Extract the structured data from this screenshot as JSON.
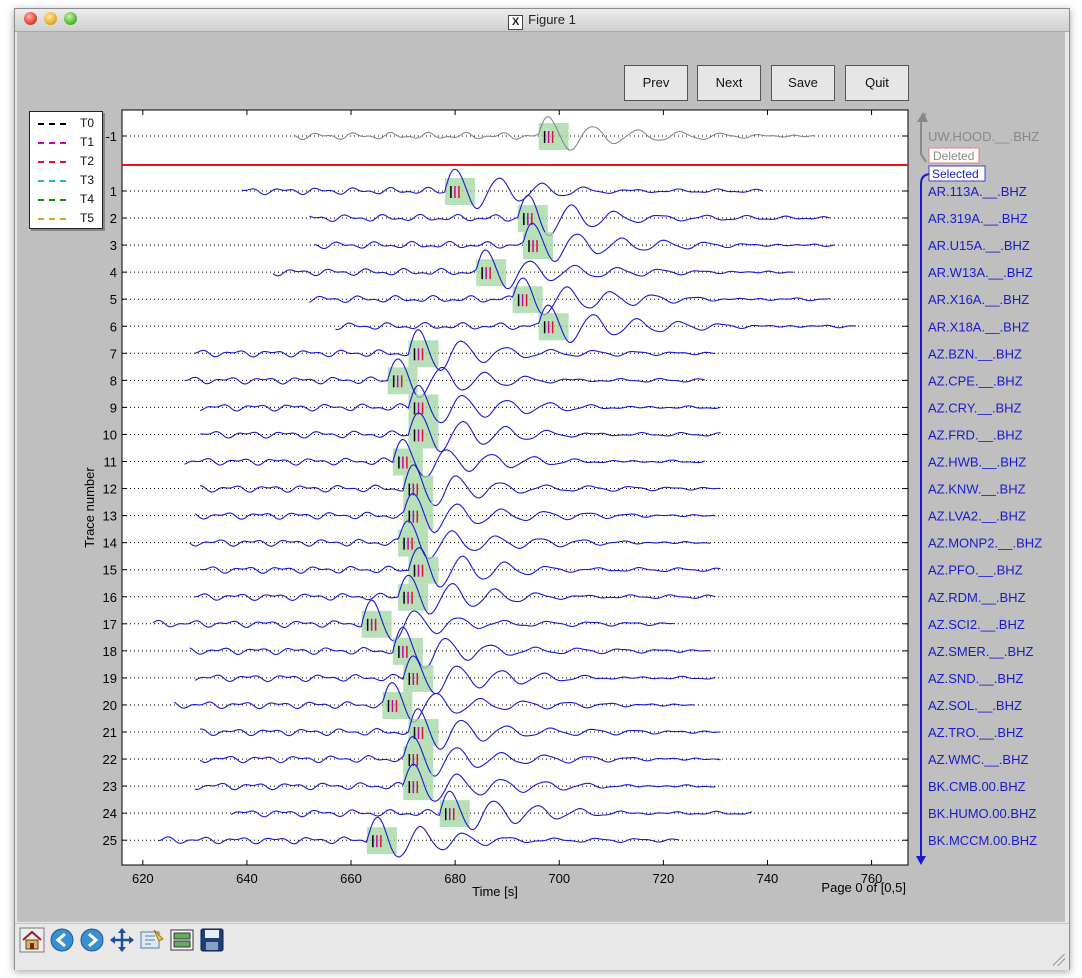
{
  "window": {
    "title": "Figure 1"
  },
  "buttons": {
    "prev": "Prev",
    "next": "Next",
    "save": "Save",
    "quit": "Quit"
  },
  "legend": [
    {
      "label": "T0",
      "color": "#000000"
    },
    {
      "label": "T1",
      "color": "#cc00aa"
    },
    {
      "label": "T2",
      "color": "#dd1133"
    },
    {
      "label": "T3",
      "color": "#22bbbb"
    },
    {
      "label": "T4",
      "color": "#118811"
    },
    {
      "label": "T5",
      "color": "#ccaa22"
    }
  ],
  "axes": {
    "xlabel": "Time [s]",
    "ylabel": "Trace number",
    "x_ticks": [
      620,
      640,
      660,
      680,
      700,
      720,
      740,
      760
    ],
    "x_range": [
      616,
      767
    ],
    "page_text": "Page 0 of [0,5]"
  },
  "labels": {
    "deleted": "Deleted",
    "selected": "Selected"
  },
  "colors": {
    "selected": "#1a1acc",
    "deleted": "#888888",
    "separator": "#ee1111",
    "pick_box": "#9fd5a0"
  },
  "chart_data": {
    "type": "line",
    "deleted_trace": {
      "number": "-1",
      "station": "UW.HOOD.__.BHZ",
      "start": 649,
      "end": 749,
      "pick": 697
    },
    "traces": [
      {
        "number": "1",
        "station": "AR.113A.__.BHZ",
        "start": 639,
        "end": 739,
        "pick": 679
      },
      {
        "number": "2",
        "station": "AR.319A.__.BHZ",
        "start": 652,
        "end": 752,
        "pick": 693
      },
      {
        "number": "3",
        "station": "AR.U15A.__.BHZ",
        "start": 653,
        "end": 753,
        "pick": 694
      },
      {
        "number": "4",
        "station": "AR.W13A.__.BHZ",
        "start": 645,
        "end": 745,
        "pick": 685
      },
      {
        "number": "5",
        "station": "AR.X16A.__.BHZ",
        "start": 652,
        "end": 752,
        "pick": 692
      },
      {
        "number": "6",
        "station": "AR.X18A.__.BHZ",
        "start": 657,
        "end": 757,
        "pick": 697
      },
      {
        "number": "7",
        "station": "AZ.BZN.__.BHZ",
        "start": 630,
        "end": 730,
        "pick": 672
      },
      {
        "number": "8",
        "station": "AZ.CPE.__.BHZ",
        "start": 628,
        "end": 728,
        "pick": 668
      },
      {
        "number": "9",
        "station": "AZ.CRY.__.BHZ",
        "start": 631,
        "end": 731,
        "pick": 672
      },
      {
        "number": "10",
        "station": "AZ.FRD.__.BHZ",
        "start": 631,
        "end": 731,
        "pick": 672
      },
      {
        "number": "11",
        "station": "AZ.HWB.__.BHZ",
        "start": 628,
        "end": 728,
        "pick": 669
      },
      {
        "number": "12",
        "station": "AZ.KNW.__.BHZ",
        "start": 631,
        "end": 731,
        "pick": 671
      },
      {
        "number": "13",
        "station": "AZ.LVA2.__.BHZ",
        "start": 630,
        "end": 730,
        "pick": 671
      },
      {
        "number": "14",
        "station": "AZ.MONP2.__.BHZ",
        "start": 629,
        "end": 729,
        "pick": 670
      },
      {
        "number": "15",
        "station": "AZ.PFO.__.BHZ",
        "start": 631,
        "end": 731,
        "pick": 672
      },
      {
        "number": "16",
        "station": "AZ.RDM.__.BHZ",
        "start": 630,
        "end": 730,
        "pick": 670
      },
      {
        "number": "17",
        "station": "AZ.SCI2.__.BHZ",
        "start": 622,
        "end": 722,
        "pick": 663
      },
      {
        "number": "18",
        "station": "AZ.SMER.__.BHZ",
        "start": 629,
        "end": 729,
        "pick": 669
      },
      {
        "number": "19",
        "station": "AZ.SND.__.BHZ",
        "start": 630,
        "end": 730,
        "pick": 671
      },
      {
        "number": "20",
        "station": "AZ.SOL.__.BHZ",
        "start": 626,
        "end": 726,
        "pick": 667
      },
      {
        "number": "21",
        "station": "AZ.TRO.__.BHZ",
        "start": 631,
        "end": 731,
        "pick": 672
      },
      {
        "number": "22",
        "station": "AZ.WMC.__.BHZ",
        "start": 631,
        "end": 731,
        "pick": 671
      },
      {
        "number": "23",
        "station": "BK.CMB.00.BHZ",
        "start": 630,
        "end": 730,
        "pick": 671
      },
      {
        "number": "24",
        "station": "BK.HUMO.00.BHZ",
        "start": 637,
        "end": 737,
        "pick": 678
      },
      {
        "number": "25",
        "station": "BK.MCCM.00.BHZ",
        "start": 623,
        "end": 723,
        "pick": 664
      }
    ]
  },
  "toolbar": [
    {
      "icon": "home-icon"
    },
    {
      "icon": "back-arrow-icon"
    },
    {
      "icon": "forward-arrow-icon"
    },
    {
      "icon": "pan-move-icon"
    },
    {
      "icon": "zoom-rect-icon"
    },
    {
      "icon": "subplots-config-icon"
    },
    {
      "icon": "save-disk-icon"
    }
  ]
}
